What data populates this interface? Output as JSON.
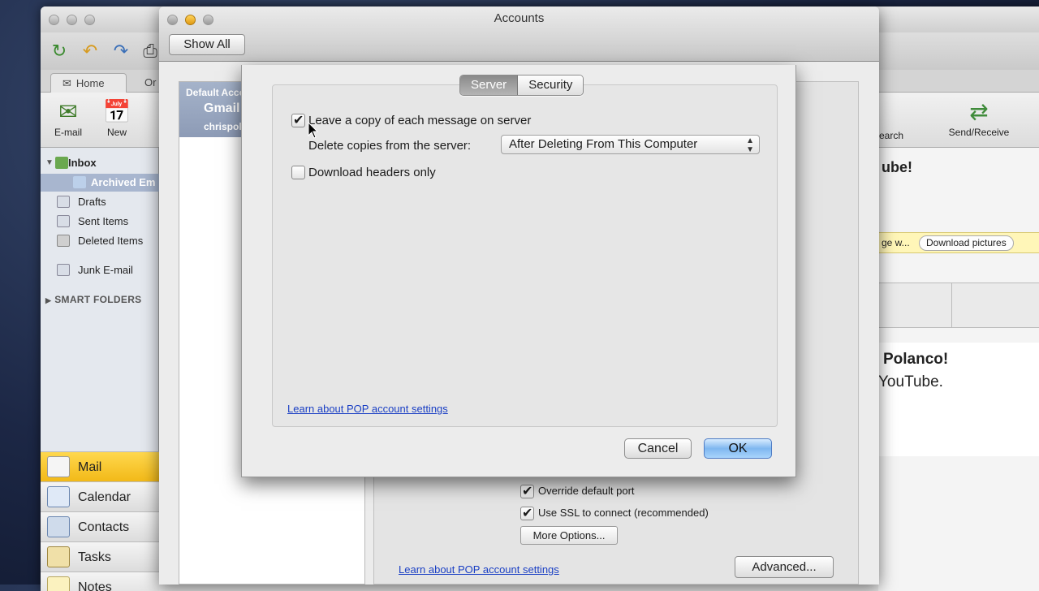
{
  "outlook": {
    "home_tab": "Home",
    "second_tab": "Or",
    "ribbon": {
      "email_label": "E-mail",
      "new_label": "New",
      "search_label": "Search",
      "send_receive_label": "Send/Receive"
    },
    "folders": {
      "inbox": "Inbox",
      "archived": "Archived Em",
      "drafts": "Drafts",
      "sent": "Sent Items",
      "deleted": "Deleted Items",
      "junk": "Junk E-mail",
      "smart_folders": "SMART FOLDERS"
    },
    "nav": [
      "Mail",
      "Calendar",
      "Contacts",
      "Tasks",
      "Notes"
    ],
    "right_pane": {
      "heading": "ube!",
      "download_prefix": "ge w...",
      "download_button": "Download pictures",
      "greeting": "Polanco!",
      "body": "YouTube."
    }
  },
  "accounts": {
    "window_title": "Accounts",
    "show_all": "Show All",
    "account_list": {
      "default_label": "Default Accou",
      "name": "Gmail",
      "address": "chrispol"
    },
    "panel": {
      "override_port": "Override default port",
      "use_ssl": "Use SSL to connect (recommended)",
      "more_options": "More Options...",
      "learn_link": "Learn about POP account settings",
      "advanced": "Advanced..."
    }
  },
  "sheet": {
    "tabs": {
      "server": "Server",
      "security": "Security"
    },
    "leave_copy_label": "Leave a copy of each message on server",
    "leave_copy_checked": true,
    "delete_copies_label": "Delete copies from the server:",
    "delete_copies_value": "After Deleting From This Computer",
    "download_headers_label": "Download headers only",
    "download_headers_checked": false,
    "learn_link": "Learn about POP account settings",
    "cancel": "Cancel",
    "ok": "OK"
  }
}
